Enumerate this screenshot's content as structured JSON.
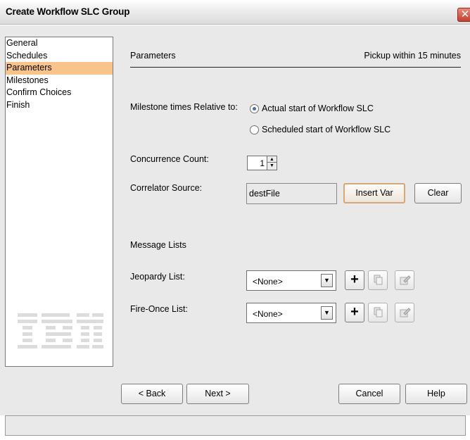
{
  "window": {
    "title": "Create Workflow SLC Group",
    "close_icon": "close-icon"
  },
  "sidebar": {
    "items": [
      {
        "label": "General"
      },
      {
        "label": "Schedules"
      },
      {
        "label": "Parameters",
        "active": true
      },
      {
        "label": "Milestones"
      },
      {
        "label": "Confirm Choices"
      },
      {
        "label": "Finish"
      }
    ],
    "active_color": "#f8c48c",
    "logo": "ibm-logo"
  },
  "panel": {
    "title": "Parameters",
    "subtitle": "Pickup within 15 minutes",
    "milestone": {
      "label": "Milestone times Relative to:",
      "options": [
        {
          "label": "Actual start of Workflow SLC",
          "selected": true
        },
        {
          "label": "Scheduled start of Workflow SLC",
          "selected": false
        }
      ]
    },
    "concurrence": {
      "label": "Concurrence Count:",
      "value": "1"
    },
    "correlator": {
      "label": "Correlator Source:",
      "value": "destFile",
      "insert_label": "Insert Var",
      "clear_label": "Clear"
    },
    "message_lists_heading": "Message Lists",
    "jeopardy": {
      "label": "Jeopardy List:",
      "value": "<None>"
    },
    "fire_once": {
      "label": "Fire-Once List:",
      "value": "<None>"
    }
  },
  "footer": {
    "back_label": "< Back",
    "next_label": "Next >",
    "cancel_label": "Cancel",
    "help_label": "Help"
  }
}
